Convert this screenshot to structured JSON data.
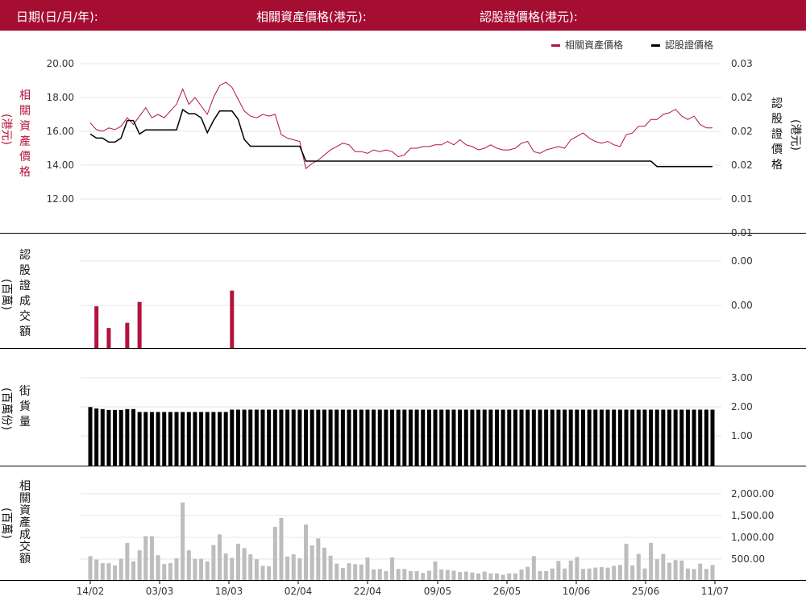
{
  "header": {
    "date_label": "日期(日/月/年):",
    "underlying_label": "相關資產價格(港元):",
    "warrant_label": "認股證價格(港元):"
  },
  "legend": {
    "underlying": "相關資產價格",
    "warrant": "認股證價格"
  },
  "panels": {
    "price": {
      "left_label": [
        "相",
        "關",
        "資",
        "產",
        "價",
        "格"
      ],
      "left_unit": "(港元)",
      "right_label": [
        "認",
        "股",
        "證",
        "價",
        "格"
      ],
      "right_unit": "(港元)"
    },
    "warrant_turnover": {
      "label": [
        "認",
        "股",
        "證",
        "成",
        "交",
        "額"
      ],
      "unit": "(百萬)"
    },
    "outstanding": {
      "label": [
        "街",
        "貨",
        "量"
      ],
      "unit": "(百萬份)"
    },
    "underlying_turnover": {
      "label": [
        "相",
        "關",
        "資",
        "產",
        "成",
        "交",
        "額"
      ],
      "unit": "(百萬)"
    }
  },
  "colors": {
    "header_bg": "#a50d33",
    "underlying_line": "#b5123e",
    "warrant_line": "#000000",
    "warrant_turnover_bar": "#b5123e",
    "outstanding_bar": "#000000",
    "underlying_turnover_bar": "#bdbdbd"
  },
  "chart_data": [
    {
      "type": "line",
      "x": [
        "14/02",
        "03/03",
        "18/03",
        "02/04",
        "22/04",
        "09/05",
        "26/05",
        "10/06",
        "25/06",
        "11/07"
      ],
      "y_left_ticks": [
        "20.00",
        "18.00",
        "16.00",
        "14.00",
        "12.00"
      ],
      "y_right_ticks": [
        "0.03",
        "0.02",
        "0.02",
        "0.02",
        "0.01",
        "0.01"
      ],
      "ylim_left": [
        12,
        20
      ],
      "grid": true,
      "legend_position": "top-right",
      "series": [
        {
          "name": "相關資產價格",
          "axis": "left",
          "values": [
            16.5,
            16.1,
            16.0,
            16.2,
            16.1,
            16.3,
            16.8,
            16.4,
            16.9,
            17.4,
            16.8,
            17.0,
            16.8,
            17.2,
            17.6,
            18.5,
            17.6,
            18.0,
            17.5,
            17.0,
            18.0,
            18.7,
            18.9,
            18.6,
            17.9,
            17.2,
            16.9,
            16.8,
            17.0,
            16.9,
            17.0,
            15.8,
            15.6,
            15.5,
            15.4,
            13.8,
            14.1,
            14.3,
            14.6,
            14.9,
            15.1,
            15.3,
            15.2,
            14.8,
            14.8,
            14.7,
            14.9,
            14.8,
            14.9,
            14.8,
            14.5,
            14.6,
            15.0,
            15.0,
            15.1,
            15.1,
            15.2,
            15.2,
            15.4,
            15.2,
            15.5,
            15.2,
            15.1,
            14.9,
            15.0,
            15.2,
            15.0,
            14.9,
            14.9,
            15.0,
            15.3,
            15.4,
            14.8,
            14.7,
            14.9,
            15.0,
            15.1,
            15.0,
            15.5,
            15.7,
            15.9,
            15.6,
            15.4,
            15.3,
            15.4,
            15.2,
            15.1,
            15.8,
            15.9,
            16.3,
            16.3,
            16.7,
            16.7,
            17.0,
            17.1,
            17.3,
            16.9,
            16.7,
            16.9,
            16.4,
            16.2,
            16.2
          ]
        },
        {
          "name": "認股證價格",
          "axis": "right",
          "values": [
            0.0196,
            0.019,
            0.019,
            0.0184,
            0.0184,
            0.019,
            0.0216,
            0.0216,
            0.0196,
            0.0202,
            0.0202,
            0.0202,
            0.0202,
            0.0202,
            0.0202,
            0.0232,
            0.0226,
            0.0226,
            0.022,
            0.0198,
            0.0216,
            0.023,
            0.023,
            0.023,
            0.0218,
            0.0188,
            0.0178,
            0.0178,
            0.0178,
            0.0178,
            0.0178,
            0.0178,
            0.0178,
            0.0178,
            0.0178,
            0.0156,
            0.0156,
            0.0156,
            0.0156,
            0.0156,
            0.0156,
            0.0156,
            0.0156,
            0.0156,
            0.0156,
            0.0156,
            0.0156,
            0.0156,
            0.0156,
            0.0156,
            0.0156,
            0.0156,
            0.0156,
            0.0156,
            0.0156,
            0.0156,
            0.0156,
            0.0156,
            0.0156,
            0.0156,
            0.0156,
            0.0156,
            0.0156,
            0.0156,
            0.0156,
            0.0156,
            0.0156,
            0.0156,
            0.0156,
            0.0156,
            0.0156,
            0.0156,
            0.0156,
            0.0156,
            0.0156,
            0.0156,
            0.0156,
            0.0156,
            0.0156,
            0.0156,
            0.0156,
            0.0156,
            0.0156,
            0.0156,
            0.0156,
            0.0156,
            0.0156,
            0.0156,
            0.0156,
            0.0156,
            0.0156,
            0.0156,
            0.0148,
            0.0148,
            0.0148,
            0.0148,
            0.0148,
            0.0148,
            0.0148,
            0.0148,
            0.0148,
            0.0148
          ]
        }
      ]
    },
    {
      "type": "bar",
      "name": "認股證成交額",
      "y_ticks": [
        "0.00",
        "0.00"
      ],
      "ylim": [
        0,
        1
      ],
      "values": [
        0,
        0.48,
        0,
        0.23,
        0,
        0,
        0.29,
        0,
        0.53,
        0,
        0,
        0,
        0,
        0,
        0,
        0,
        0,
        0,
        0,
        0,
        0,
        0,
        0,
        0.66,
        0,
        0,
        0,
        0,
        0,
        0,
        0,
        0,
        0,
        0,
        0,
        0,
        0,
        0,
        0,
        0,
        0,
        0,
        0,
        0,
        0,
        0,
        0,
        0,
        0,
        0,
        0,
        0,
        0,
        0,
        0,
        0,
        0,
        0,
        0,
        0,
        0,
        0,
        0,
        0,
        0,
        0,
        0,
        0,
        0,
        0,
        0,
        0,
        0,
        0,
        0,
        0,
        0,
        0,
        0,
        0,
        0,
        0,
        0,
        0,
        0,
        0,
        0,
        0,
        0,
        0,
        0,
        0,
        0,
        0,
        0,
        0,
        0,
        0,
        0,
        0,
        0,
        0
      ]
    },
    {
      "type": "bar",
      "name": "街貨量",
      "y_ticks": [
        "3.00",
        "2.00",
        "1.00"
      ],
      "ylim": [
        0,
        3.2
      ],
      "values": [
        2.02,
        1.97,
        1.95,
        1.92,
        1.92,
        1.92,
        1.95,
        1.95,
        1.85,
        1.85,
        1.85,
        1.85,
        1.85,
        1.85,
        1.85,
        1.85,
        1.85,
        1.85,
        1.85,
        1.85,
        1.85,
        1.85,
        1.85,
        1.93,
        1.93,
        1.93,
        1.93,
        1.93,
        1.93,
        1.93,
        1.93,
        1.93,
        1.93,
        1.93,
        1.93,
        1.93,
        1.93,
        1.93,
        1.93,
        1.93,
        1.93,
        1.93,
        1.93,
        1.93,
        1.93,
        1.93,
        1.93,
        1.93,
        1.93,
        1.93,
        1.93,
        1.93,
        1.93,
        1.93,
        1.93,
        1.93,
        1.93,
        1.93,
        1.93,
        1.93,
        1.93,
        1.93,
        1.93,
        1.93,
        1.93,
        1.93,
        1.93,
        1.93,
        1.93,
        1.93,
        1.93,
        1.93,
        1.93,
        1.93,
        1.93,
        1.93,
        1.93,
        1.93,
        1.93,
        1.93,
        1.93,
        1.93,
        1.93,
        1.93,
        1.93,
        1.93,
        1.93,
        1.93,
        1.93,
        1.93,
        1.93,
        1.93,
        1.93,
        1.93,
        1.93,
        1.93,
        1.93,
        1.93,
        1.93,
        1.93,
        1.93,
        1.93
      ]
    },
    {
      "type": "bar",
      "name": "相關資產成交額",
      "y_ticks": [
        "2,000.00",
        "1,500.00",
        "1,000.00",
        "500.00"
      ],
      "ylim": [
        0,
        2150
      ],
      "values": [
        540,
        460,
        380,
        380,
        330,
        480,
        840,
        420,
        670,
        990,
        990,
        560,
        360,
        380,
        490,
        1750,
        670,
        480,
        480,
        420,
        790,
        1030,
        600,
        500,
        820,
        720,
        580,
        470,
        320,
        310,
        1200,
        1400,
        530,
        580,
        490,
        1250,
        780,
        940,
        730,
        550,
        370,
        270,
        380,
        360,
        350,
        510,
        240,
        250,
        200,
        510,
        250,
        250,
        200,
        200,
        160,
        210,
        420,
        240,
        230,
        210,
        180,
        190,
        170,
        150,
        190,
        150,
        150,
        120,
        150,
        150,
        240,
        300,
        540,
        200,
        200,
        260,
        430,
        260,
        440,
        520,
        250,
        260,
        280,
        290,
        280,
        320,
        340,
        820,
        330,
        590,
        260,
        840,
        470,
        590,
        390,
        450,
        440,
        260,
        250,
        370,
        250,
        340
      ]
    }
  ]
}
